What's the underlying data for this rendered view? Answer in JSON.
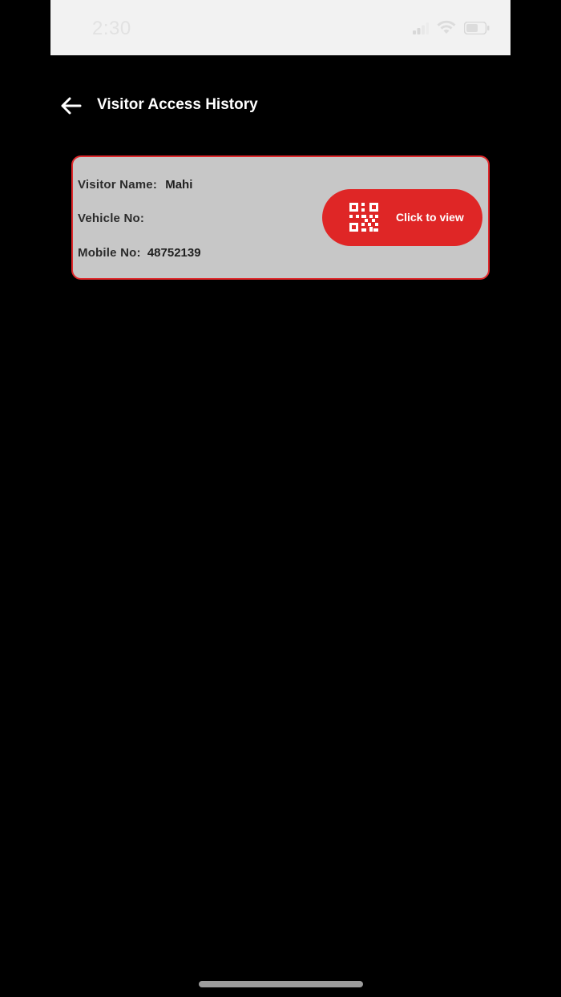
{
  "status_bar": {
    "time": "2:30",
    "icons": [
      "signal-icon",
      "wifi-icon",
      "battery-icon"
    ]
  },
  "header": {
    "back_icon": "arrow-left-icon",
    "title": "Visitor Access History"
  },
  "visitors": [
    {
      "name_label": "Visitor Name:",
      "name_value": "Mahi",
      "vehicle_label": "Vehicle No:",
      "vehicle_value": "",
      "mobile_label": "Mobile No:",
      "mobile_value": "48752139",
      "qr_button_label": "Click to view",
      "qr_icon": "qr-code-icon"
    }
  ],
  "colors": {
    "background": "#000000",
    "card_background": "#c7c7c7",
    "accent_red": "#df2626",
    "title_text": "#ffffff"
  }
}
